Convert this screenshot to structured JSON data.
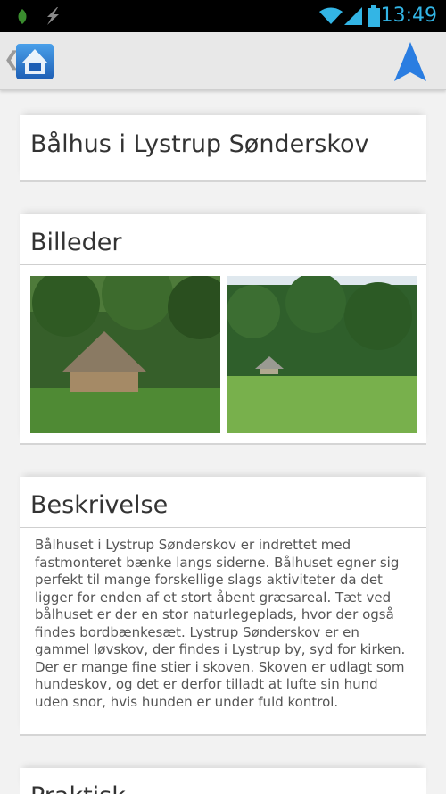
{
  "status_bar": {
    "time": "13:49",
    "icons": [
      "leaf-icon",
      "lightning-icon",
      "wifi-icon",
      "signal-icon",
      "battery-icon"
    ]
  },
  "action_bar": {
    "back_glyph": "❮",
    "app_icon": "app-logo-icon",
    "navigation_icon": "navigation-arrow-icon"
  },
  "place": {
    "title": "Bålhus i Lystrup Sønderskov"
  },
  "photos": {
    "heading": "Billeder",
    "items": [
      "shelter-photo",
      "meadow-photo"
    ]
  },
  "description": {
    "heading": "Beskrivelse",
    "text": "Bålhuset i Lystrup Sønderskov er indrettet med fastmonteret bænke langs siderne. Bålhuset egner sig perfekt til mange forskellige slags aktiviteter da det ligger for enden af et stort åbent græsareal. Tæt ved bålhuset er der en stor naturlegeplads, hvor der også findes bordbænkesæt. Lystrup Sønderskov er en gammel løvskov, der findes i Lystrup by, syd for kirken. Der er mange fine stier i skoven. Skoven er udlagt som hundeskov, og det er derfor tilladt at lufte sin hund uden snor, hvis hunden er under fuld kontrol."
  },
  "practical": {
    "heading": "Praktisk"
  },
  "colors": {
    "accent": "#33b5e5",
    "nav_arrow": "#2a7de1"
  }
}
